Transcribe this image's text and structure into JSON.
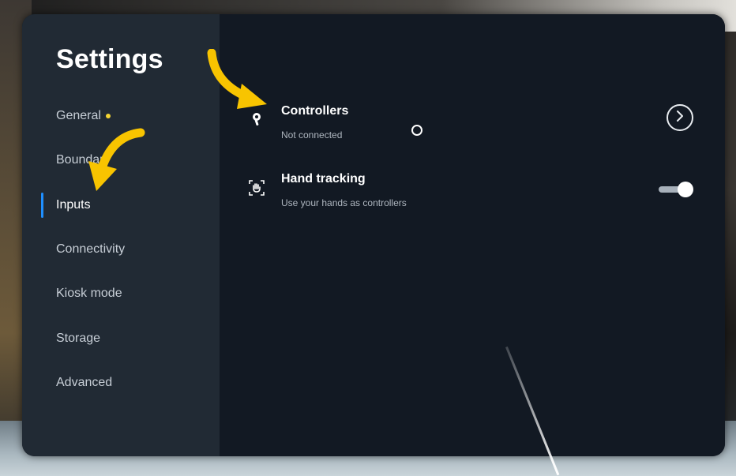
{
  "sidebar": {
    "title": "Settings",
    "items": [
      {
        "label": "General",
        "has_dot": true
      },
      {
        "label": "Boundary"
      },
      {
        "label": "Inputs",
        "active": true
      },
      {
        "label": "Connectivity"
      },
      {
        "label": "Kiosk mode"
      },
      {
        "label": "Storage"
      },
      {
        "label": "Advanced"
      }
    ]
  },
  "main": {
    "rows": [
      {
        "title": "Controllers",
        "subtitle": "Not connected",
        "icon": "controller-icon",
        "action": "chevron-right"
      },
      {
        "title": "Hand tracking",
        "subtitle": "Use your hands as controllers",
        "icon": "hand-icon",
        "action": "toggle",
        "toggle_on": true
      }
    ]
  },
  "colors": {
    "accent": "#1f8fff",
    "dot": "#f5d533",
    "annotation_arrow": "#f8c400",
    "panel": "#121923",
    "sidebar": "#212a34"
  }
}
